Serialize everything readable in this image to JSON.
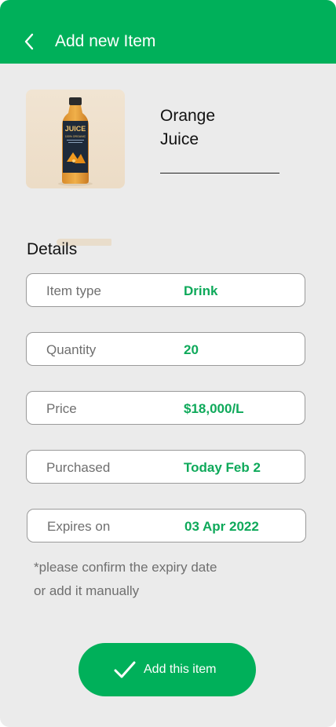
{
  "header": {
    "title": "Add new Item",
    "back_icon": "chevron-left-icon"
  },
  "product": {
    "name_line1": "Orange",
    "name_line2": "Juice",
    "label_text": "JUICE",
    "label_subtext": "100% ORGANIC"
  },
  "details": {
    "title": "Details",
    "fields": [
      {
        "label": "Item type",
        "value": "Drink"
      },
      {
        "label": "Quantity",
        "value": "20"
      },
      {
        "label": "Price",
        "value": "$18,000/L"
      },
      {
        "label": "Purchased",
        "value": "Today Feb 2"
      },
      {
        "label": "Expires on",
        "value": "03 Apr 2022"
      }
    ],
    "note_line1": "*please confirm the expiry date",
    "note_line2": "or add it manually"
  },
  "action": {
    "label": "Add this item",
    "icon": "checkmark-icon"
  },
  "colors": {
    "accent": "#00b05a",
    "value_text": "#0ea95a",
    "background": "#ebebeb"
  }
}
